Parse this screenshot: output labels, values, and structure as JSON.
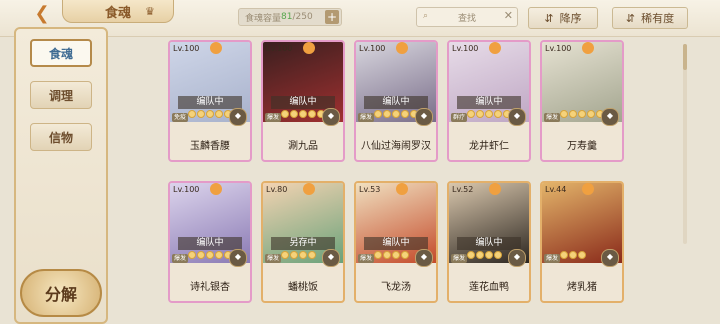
{
  "header": {
    "title": "食魂",
    "capacity_label": "食魂容量",
    "capacity_current": "81",
    "capacity_max": "/250",
    "search_placeholder": "查找",
    "sort_label": "降序",
    "rarity_label": "稀有度"
  },
  "sidebar": {
    "items": [
      {
        "label": "食魂",
        "active": true
      },
      {
        "label": "调理",
        "active": false
      },
      {
        "label": "信物",
        "active": false
      }
    ],
    "decompose_label": "分解"
  },
  "cards": [
    {
      "level": "Lv.100",
      "name": "玉麟香腰",
      "status": "编队中",
      "tag": "免疫",
      "frame": "pink",
      "stars": 5,
      "art": [
        "#cfd6e8",
        "#a8b2cc"
      ]
    },
    {
      "level": "Lv.100",
      "name": "涮九品",
      "status": "编队中",
      "tag": "爆发",
      "frame": "pink",
      "stars": 5,
      "art": [
        "#3a1f1f",
        "#a03030"
      ]
    },
    {
      "level": "Lv.100",
      "name": "八仙过海闹罗汉",
      "status": "编队中",
      "tag": "爆发",
      "frame": "pink",
      "stars": 5,
      "art": [
        "#d8d6de",
        "#7a6e8a"
      ]
    },
    {
      "level": "Lv.100",
      "name": "龙井虾仁",
      "status": "编队中",
      "tag": "群疗",
      "frame": "pink",
      "stars": 5,
      "art": [
        "#e7dce8",
        "#bfa7c4"
      ]
    },
    {
      "level": "Lv.100",
      "name": "万寿羹",
      "status": "",
      "tag": "爆发",
      "frame": "pink",
      "stars": 5,
      "art": [
        "#e6e2d2",
        "#a3a58f"
      ]
    },
    {
      "level": "Lv.100",
      "name": "诗礼银杏",
      "status": "编队中",
      "tag": "爆发",
      "frame": "pink",
      "stars": 5,
      "art": [
        "#dcd4ec",
        "#8a7ab4"
      ]
    },
    {
      "level": "Lv.80",
      "name": "蟠桃饭",
      "status": "另存中",
      "tag": "爆发",
      "frame": "gold",
      "stars": 4,
      "art": [
        "#f3d3b2",
        "#6aa27a"
      ]
    },
    {
      "level": "Lv.53",
      "name": "飞龙汤",
      "status": "编队中",
      "tag": "爆发",
      "frame": "gold",
      "stars": 4,
      "art": [
        "#f0e0c0",
        "#c44a2a"
      ]
    },
    {
      "level": "Lv.52",
      "name": "莲花血鸭",
      "status": "编队中",
      "tag": "爆发",
      "frame": "gold",
      "stars": 4,
      "art": [
        "#d9c7ad",
        "#2c2620"
      ]
    },
    {
      "level": "Lv.44",
      "name": "烤乳猪",
      "status": "",
      "tag": "爆发",
      "frame": "gold",
      "stars": 3,
      "art": [
        "#e3b46a",
        "#8a2a1a"
      ]
    }
  ],
  "colors": {
    "pink_frame": "#e49bc8",
    "gold_frame": "#e3b06a",
    "accent": "#b58a4a"
  }
}
